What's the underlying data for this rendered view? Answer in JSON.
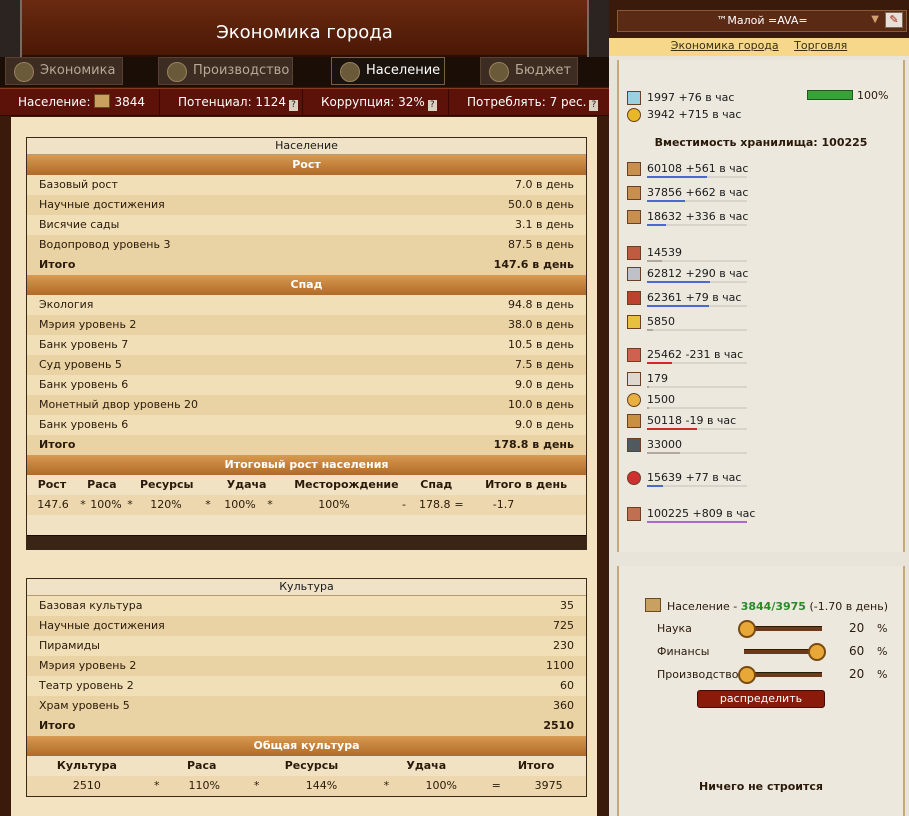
{
  "header": {
    "title": "Экономика города"
  },
  "tabs": [
    {
      "label": "Экономика",
      "icon": "pie-chart-icon"
    },
    {
      "label": "Производство",
      "icon": "gears-icon"
    },
    {
      "label": "Население",
      "icon": "person-icon"
    },
    {
      "label": "Бюджет",
      "icon": "coins-icon"
    }
  ],
  "stats": {
    "population_label": "Население:",
    "population_value": "3844",
    "potential": "Потенциал: 1124",
    "corruption": "Коррупция: 32%",
    "consume": "Потреблять: 7 рес.",
    "help": "?"
  },
  "population_panel": {
    "title": "Население",
    "growth_title": "Рост",
    "growth": [
      {
        "name": "Базовый рост",
        "value": "7.0 в день"
      },
      {
        "name": "Научные достижения",
        "value": "50.0 в день"
      },
      {
        "name": "Висячие сады",
        "value": "3.1 в день"
      },
      {
        "name": "Водопровод уровень 3",
        "value": "87.5 в день"
      }
    ],
    "growth_total": {
      "name": "Итого",
      "value": "147.6 в день"
    },
    "decline_title": "Спад",
    "decline": [
      {
        "name": "Экология",
        "value": "94.8 в день"
      },
      {
        "name": "Мэрия уровень 2",
        "value": "38.0 в день"
      },
      {
        "name": "Банк уровень 7",
        "value": "10.5 в день"
      },
      {
        "name": "Суд уровень 5",
        "value": "7.5 в день"
      },
      {
        "name": "Банк уровень 6",
        "value": "9.0 в день"
      },
      {
        "name": "Монетный двор уровень 20",
        "value": "10.0 в день"
      },
      {
        "name": "Банк уровень 6",
        "value": "9.0 в день"
      }
    ],
    "decline_total": {
      "name": "Итого",
      "value": "178.8 в день"
    },
    "result_title": "Итоговый рост населения",
    "result_head": [
      "Рост",
      "Раса",
      "Ресурсы",
      "Удача",
      "Месторождение",
      "Спад",
      "Итого в день"
    ],
    "result_values": [
      "147.6",
      "*",
      "100%",
      "*",
      "120%",
      "*",
      "100%",
      "*",
      "100%",
      "-",
      "178.8",
      "=",
      "-1.7"
    ]
  },
  "culture_panel": {
    "title": "Культура",
    "items": [
      {
        "name": "Базовая культура",
        "value": "35"
      },
      {
        "name": "Научные достижения",
        "value": "725"
      },
      {
        "name": "Пирамиды",
        "value": "230"
      },
      {
        "name": "Мэрия уровень 2",
        "value": "1100"
      },
      {
        "name": "Театр уровень 2",
        "value": "60"
      },
      {
        "name": "Храм уровень 5",
        "value": "360"
      }
    ],
    "total": {
      "name": "Итого",
      "value": "2510"
    },
    "general_title": "Общая культура",
    "general_head": [
      "Культура",
      "Раса",
      "Ресурсы",
      "Удача",
      "Итого"
    ],
    "general_values": [
      "2510",
      "*",
      "110%",
      "*",
      "144%",
      "*",
      "100%",
      "=",
      "3975"
    ]
  },
  "sidebar": {
    "player": "™Малой =AVA=",
    "link_economy": "Экономика города",
    "link_trade": "Торговля",
    "happiness": "100%",
    "top": [
      {
        "text": "1997 +76 в час",
        "icon": "science-icon"
      },
      {
        "text": "3942 +715 в час",
        "icon": "gold-coin-icon"
      }
    ],
    "storage": "Вместимость хранилища: 100225",
    "resources": [
      {
        "text": "60108 +561 в час",
        "icon": "wood-icon",
        "fill": 0.6,
        "color": "#4a6ad0"
      },
      {
        "text": "37856 +662 в час",
        "icon": "stone-icon",
        "fill": 0.38,
        "color": "#4a6ad0"
      },
      {
        "text": "18632 +336 в час",
        "icon": "iron-icon",
        "fill": 0.19,
        "color": "#4a6ad0"
      },
      {
        "text": "14539",
        "icon": "clay-icon",
        "fill": 0.15,
        "color": "#b0a8a0"
      },
      {
        "text": "62812 +290 в час",
        "icon": "silver-icon",
        "fill": 0.63,
        "color": "#4a6ad0"
      },
      {
        "text": "62361 +79 в час",
        "icon": "crystal-icon",
        "fill": 0.62,
        "color": "#4a6ad0"
      },
      {
        "text": "5850",
        "icon": "gold-icon",
        "fill": 0.06,
        "color": "#b0a8a0"
      },
      {
        "text": "25462 -231 в час",
        "icon": "wine-icon",
        "fill": 0.25,
        "color": "#d02a2a"
      },
      {
        "text": "179",
        "icon": "cloth-icon",
        "fill": 0.02,
        "color": "#b0a8a0"
      },
      {
        "text": "1500",
        "icon": "gems-icon",
        "fill": 0.02,
        "color": "#b0a8a0"
      },
      {
        "text": "50118 -19 в час",
        "icon": "weapons-icon",
        "fill": 0.5,
        "color": "#d02a2a"
      },
      {
        "text": "33000",
        "icon": "tools-icon",
        "fill": 0.33,
        "color": "#b0a8a0"
      },
      {
        "text": "15639 +77 в час",
        "icon": "food-icon",
        "fill": 0.16,
        "color": "#4a6ad0"
      },
      {
        "text": "100225 +809 в час",
        "icon": "meat-icon",
        "fill": 1.0,
        "color": "#a86ad0"
      }
    ],
    "population_label": "Население -",
    "population_value": "3844/3975",
    "population_rate": "(-1.70 в день)",
    "sliders": [
      {
        "label": "Наука",
        "value": "20",
        "pct": "%",
        "pos": 0.2
      },
      {
        "label": "Финансы",
        "value": "60",
        "pct": "%",
        "pos": 0.9
      },
      {
        "label": "Производство",
        "value": "20",
        "pct": "%",
        "pos": 0.0
      }
    ],
    "distribute": "распределить",
    "building": "Ничего не строится"
  }
}
